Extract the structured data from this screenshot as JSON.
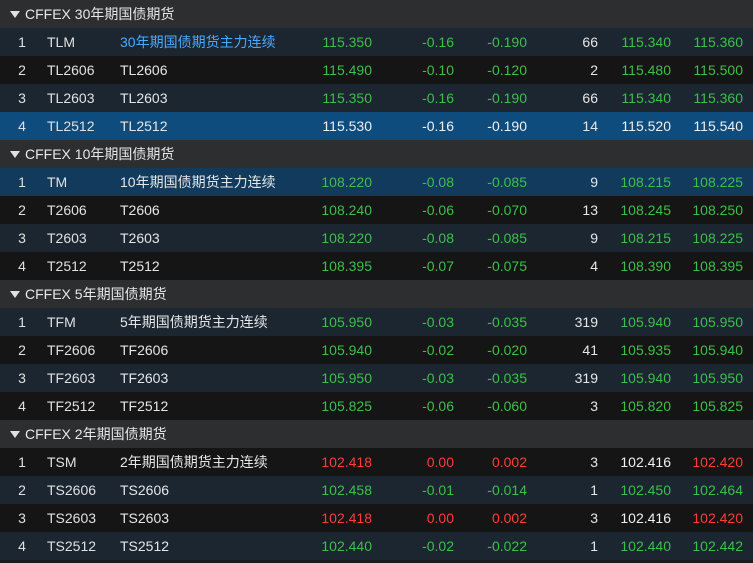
{
  "groups": [
    {
      "title": "CFFEX 30年期国债期货",
      "rows": [
        {
          "idx": "1",
          "code": "TLM",
          "name": "30年期国债期货主力连续",
          "last": "115.350",
          "chg": "-0.16",
          "pct": "-0.190",
          "vol": "66",
          "bid": "115.340",
          "ask": "115.360",
          "c_last": "green",
          "c_chg": "green",
          "c_pct": "green",
          "c_bid": "green",
          "c_ask": "green",
          "name_link": true,
          "state": "odd"
        },
        {
          "idx": "2",
          "code": "TL2606",
          "name": "TL2606",
          "last": "115.490",
          "chg": "-0.10",
          "pct": "-0.120",
          "vol": "2",
          "bid": "115.480",
          "ask": "115.500",
          "c_last": "green",
          "c_chg": "green",
          "c_pct": "green",
          "c_bid": "green",
          "c_ask": "green",
          "state": "even"
        },
        {
          "idx": "3",
          "code": "TL2603",
          "name": "TL2603",
          "last": "115.350",
          "chg": "-0.16",
          "pct": "-0.190",
          "vol": "66",
          "bid": "115.340",
          "ask": "115.360",
          "c_last": "green",
          "c_chg": "green",
          "c_pct": "green",
          "c_bid": "green",
          "c_ask": "green",
          "state": "odd"
        },
        {
          "idx": "4",
          "code": "TL2512",
          "name": "TL2512",
          "last": "115.530",
          "chg": "-0.16",
          "pct": "-0.190",
          "vol": "14",
          "bid": "115.520",
          "ask": "115.540",
          "c_last": "white",
          "c_chg": "white",
          "c_pct": "white",
          "c_bid": "white",
          "c_ask": "white",
          "state": "selected"
        }
      ]
    },
    {
      "title": "CFFEX 10年期国债期货",
      "rows": [
        {
          "idx": "1",
          "code": "TM",
          "name": "10年期国债期货主力连续",
          "last": "108.220",
          "chg": "-0.08",
          "pct": "-0.085",
          "vol": "9",
          "bid": "108.215",
          "ask": "108.225",
          "c_last": "green",
          "c_chg": "green",
          "c_pct": "green",
          "c_bid": "green",
          "c_ask": "green",
          "state": "hover"
        },
        {
          "idx": "2",
          "code": "T2606",
          "name": "T2606",
          "last": "108.240",
          "chg": "-0.06",
          "pct": "-0.070",
          "vol": "13",
          "bid": "108.245",
          "ask": "108.250",
          "c_last": "green",
          "c_chg": "green",
          "c_pct": "green",
          "c_bid": "green",
          "c_ask": "green",
          "state": "even"
        },
        {
          "idx": "3",
          "code": "T2603",
          "name": "T2603",
          "last": "108.220",
          "chg": "-0.08",
          "pct": "-0.085",
          "vol": "9",
          "bid": "108.215",
          "ask": "108.225",
          "c_last": "green",
          "c_chg": "green",
          "c_pct": "green",
          "c_bid": "green",
          "c_ask": "green",
          "state": "odd"
        },
        {
          "idx": "4",
          "code": "T2512",
          "name": "T2512",
          "last": "108.395",
          "chg": "-0.07",
          "pct": "-0.075",
          "vol": "4",
          "bid": "108.390",
          "ask": "108.395",
          "c_last": "green",
          "c_chg": "green",
          "c_pct": "green",
          "c_bid": "green",
          "c_ask": "green",
          "state": "even"
        }
      ]
    },
    {
      "title": "CFFEX 5年期国债期货",
      "rows": [
        {
          "idx": "1",
          "code": "TFM",
          "name": "5年期国债期货主力连续",
          "last": "105.950",
          "chg": "-0.03",
          "pct": "-0.035",
          "vol": "319",
          "bid": "105.940",
          "ask": "105.950",
          "c_last": "green",
          "c_chg": "green",
          "c_pct": "green",
          "c_bid": "green",
          "c_ask": "green",
          "state": "odd"
        },
        {
          "idx": "2",
          "code": "TF2606",
          "name": "TF2606",
          "last": "105.940",
          "chg": "-0.02",
          "pct": "-0.020",
          "vol": "41",
          "bid": "105.935",
          "ask": "105.940",
          "c_last": "green",
          "c_chg": "green",
          "c_pct": "green",
          "c_bid": "green",
          "c_ask": "green",
          "state": "even"
        },
        {
          "idx": "3",
          "code": "TF2603",
          "name": "TF2603",
          "last": "105.950",
          "chg": "-0.03",
          "pct": "-0.035",
          "vol": "319",
          "bid": "105.940",
          "ask": "105.950",
          "c_last": "green",
          "c_chg": "green",
          "c_pct": "green",
          "c_bid": "green",
          "c_ask": "green",
          "state": "odd"
        },
        {
          "idx": "4",
          "code": "TF2512",
          "name": "TF2512",
          "last": "105.825",
          "chg": "-0.06",
          "pct": "-0.060",
          "vol": "3",
          "bid": "105.820",
          "ask": "105.825",
          "c_last": "green",
          "c_chg": "green",
          "c_pct": "green",
          "c_bid": "green",
          "c_ask": "green",
          "state": "even"
        }
      ]
    },
    {
      "title": "CFFEX 2年期国债期货",
      "rows": [
        {
          "idx": "1",
          "code": "TSM",
          "name": "2年期国债期货主力连续",
          "last": "102.418",
          "chg": "0.00",
          "pct": "0.002",
          "vol": "3",
          "bid": "102.416",
          "ask": "102.420",
          "c_last": "red",
          "c_chg": "red",
          "c_pct": "red",
          "c_bid": "white",
          "c_ask": "red",
          "state": "even"
        },
        {
          "idx": "2",
          "code": "TS2606",
          "name": "TS2606",
          "last": "102.458",
          "chg": "-0.01",
          "pct": "-0.014",
          "vol": "1",
          "bid": "102.450",
          "ask": "102.464",
          "c_last": "green",
          "c_chg": "green",
          "c_pct": "green",
          "c_bid": "green",
          "c_ask": "green",
          "state": "odd"
        },
        {
          "idx": "3",
          "code": "TS2603",
          "name": "TS2603",
          "last": "102.418",
          "chg": "0.00",
          "pct": "0.002",
          "vol": "3",
          "bid": "102.416",
          "ask": "102.420",
          "c_last": "red",
          "c_chg": "red",
          "c_pct": "red",
          "c_bid": "white",
          "c_ask": "red",
          "state": "even"
        },
        {
          "idx": "4",
          "code": "TS2512",
          "name": "TS2512",
          "last": "102.440",
          "chg": "-0.02",
          "pct": "-0.022",
          "vol": "1",
          "bid": "102.440",
          "ask": "102.442",
          "c_last": "green",
          "c_chg": "green",
          "c_pct": "green",
          "c_bid": "green",
          "c_ask": "green",
          "state": "odd"
        }
      ]
    }
  ]
}
